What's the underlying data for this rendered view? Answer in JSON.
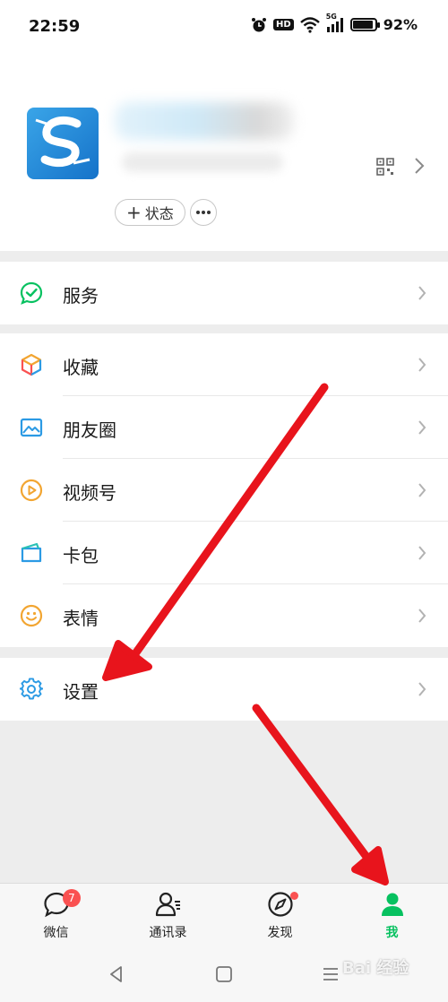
{
  "status_bar": {
    "time": "22:59",
    "network": "5G",
    "hd": "HD",
    "battery": "92%",
    "battery_level": 0.92
  },
  "profile": {
    "status_label": "状态",
    "name_blurred": true
  },
  "menu": {
    "service": {
      "label": "服务",
      "icon": "service-check-icon"
    },
    "items": [
      {
        "label": "收藏",
        "icon": "favorites-cube-icon"
      },
      {
        "label": "朋友圈",
        "icon": "moments-image-icon"
      },
      {
        "label": "视频号",
        "icon": "channels-play-icon"
      },
      {
        "label": "卡包",
        "icon": "card-wallet-icon"
      },
      {
        "label": "表情",
        "icon": "sticker-smile-icon"
      }
    ],
    "settings": {
      "label": "设置",
      "icon": "gear-icon"
    }
  },
  "tab_bar": {
    "tabs": [
      {
        "label": "微信",
        "badge": "7"
      },
      {
        "label": "通讯录"
      },
      {
        "label": "发现"
      },
      {
        "label": "我"
      }
    ]
  },
  "watermark": "Bai 经验",
  "colors": {
    "active_green": "#07c160",
    "badge_red": "#fa5151",
    "arrow_red": "#e8141c",
    "background": "#ededed"
  }
}
